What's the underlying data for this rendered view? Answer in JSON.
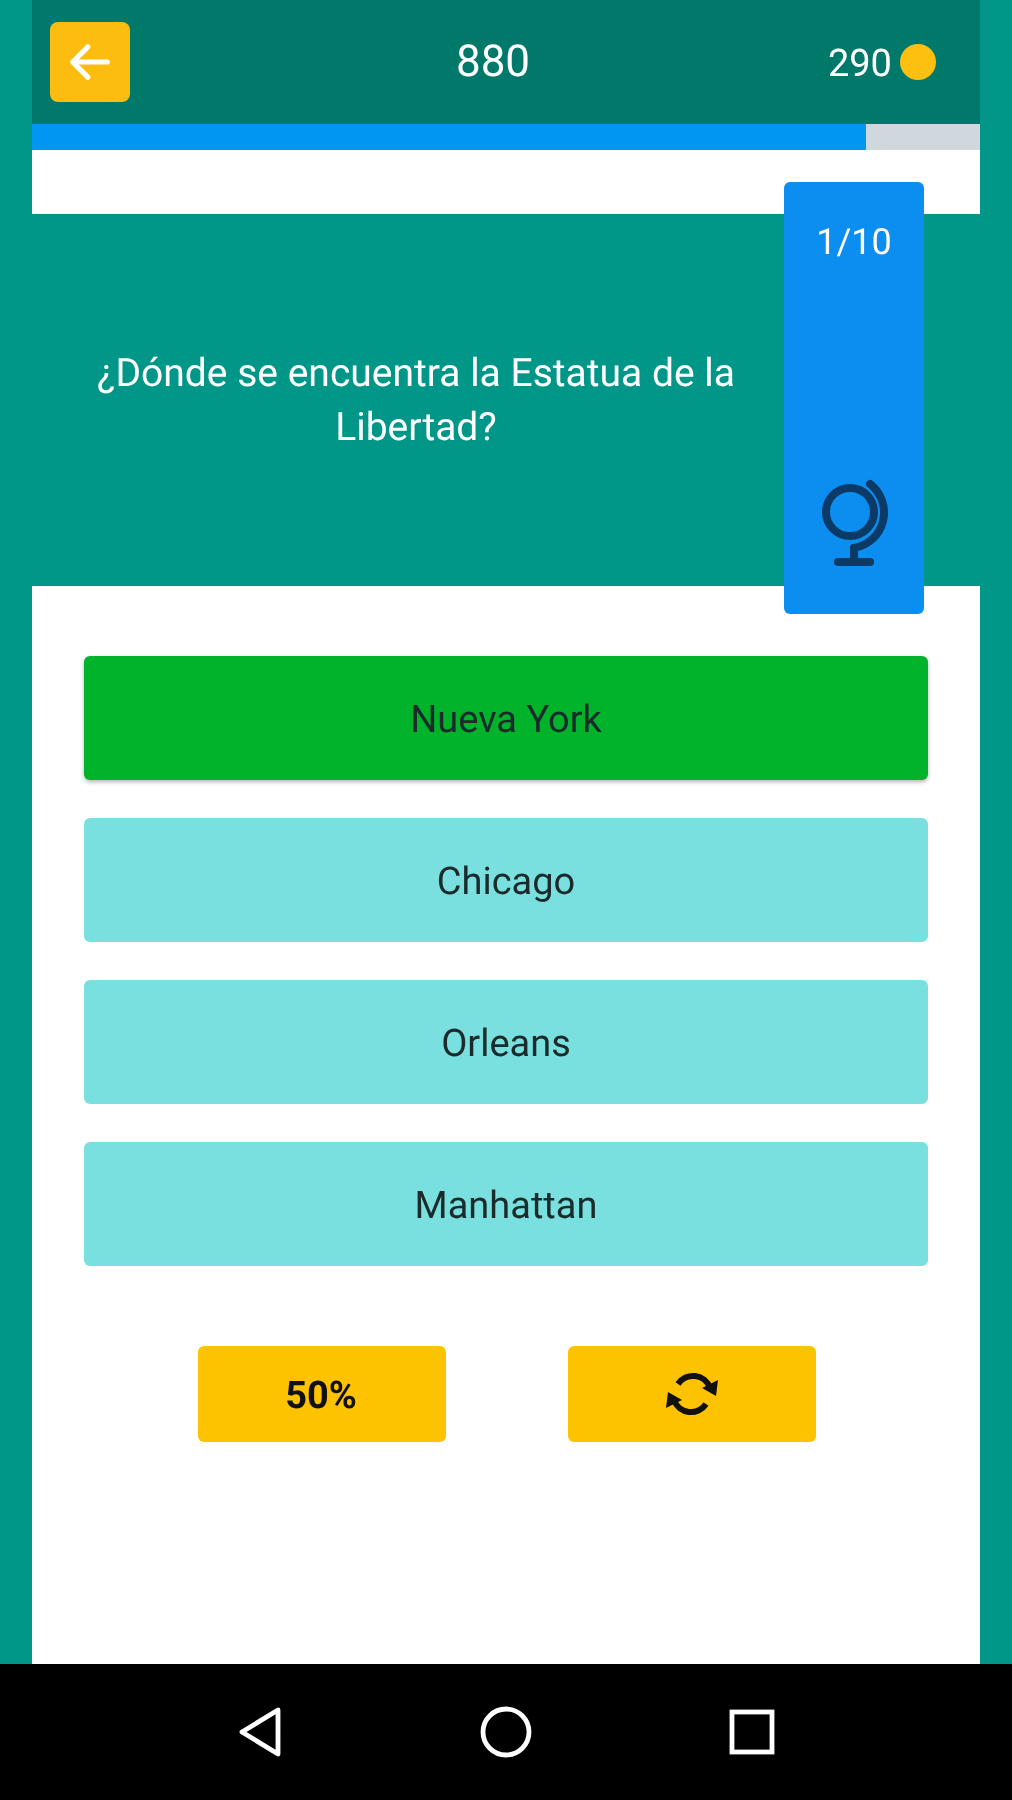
{
  "header": {
    "score": "880",
    "coins": "290"
  },
  "progress": {
    "level": 0.88
  },
  "question": {
    "text": "¿Dónde se encuentra la Estatua de la Libertad?",
    "counter": "1/10"
  },
  "answers": [
    {
      "label": "Nueva York",
      "selected": true
    },
    {
      "label": "Chicago",
      "selected": false
    },
    {
      "label": "Orleans",
      "selected": false
    },
    {
      "label": "Manhattan",
      "selected": false
    }
  ],
  "lifelines": [
    {
      "kind": "text",
      "label": "50%"
    },
    {
      "kind": "swap"
    }
  ]
}
